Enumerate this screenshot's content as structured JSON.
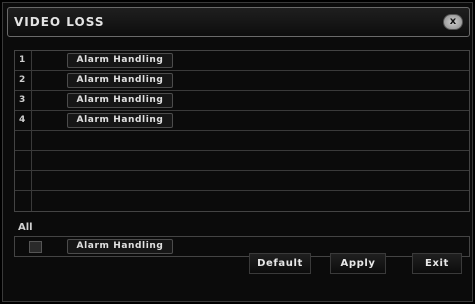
{
  "window": {
    "title": "VIDEO LOSS",
    "close_icon": "close-icon"
  },
  "channels": [
    {
      "number": "1",
      "alarm_label": "Alarm Handling"
    },
    {
      "number": "2",
      "alarm_label": "Alarm Handling"
    },
    {
      "number": "3",
      "alarm_label": "Alarm Handling"
    },
    {
      "number": "4",
      "alarm_label": "Alarm Handling"
    }
  ],
  "all": {
    "label": "All",
    "alarm_label": "Alarm Handling"
  },
  "buttons": {
    "default": "Default",
    "apply": "Apply",
    "exit": "Exit"
  }
}
